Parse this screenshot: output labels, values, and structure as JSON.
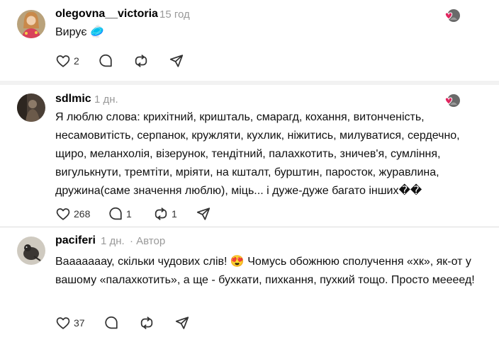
{
  "comments": [
    {
      "username": "olegovna__victoria",
      "time": "15 год",
      "author_tag": "",
      "text": "Вирує 🥏",
      "likes": "2",
      "replies": "",
      "reposts": ""
    },
    {
      "username": "sdlmic",
      "time": "1 дн.",
      "author_tag": "",
      "text": "Я люблю слова: крихітний, кришталь, смарагд, кохання, витонченість, несамовитість, серпанок, кружляти, кухлик, ніжитись, милуватися, сердечно, щиро, меланхолія, візерунок, тендітний, палахкотить, зничев'я, сумління, вигулькнути, тремтіти, мріяти, на кшталт, бурштин, паросток, журавлина, дружина(саме значення люблю), міць... і дуже-дуже багато інших��",
      "likes": "268",
      "replies": "1",
      "reposts": "1"
    },
    {
      "username": "paciferi",
      "time": "1 дн.",
      "author_tag": "· Автор",
      "text": "Вааааааау, скільки чудових слів! 😍 Чомусь обожнюю сполучення «хк», як-от у вашому «палахкотить», а ще - бухкати, пихкання, пухкий тощо. Просто меееед!",
      "likes": "37",
      "replies": "",
      "reposts": ""
    }
  ],
  "colors": {
    "heart_badge": "#e0245e",
    "meta_gray": "#999999"
  },
  "icons": [
    "heart-icon",
    "comment-icon",
    "repost-icon",
    "share-icon"
  ]
}
